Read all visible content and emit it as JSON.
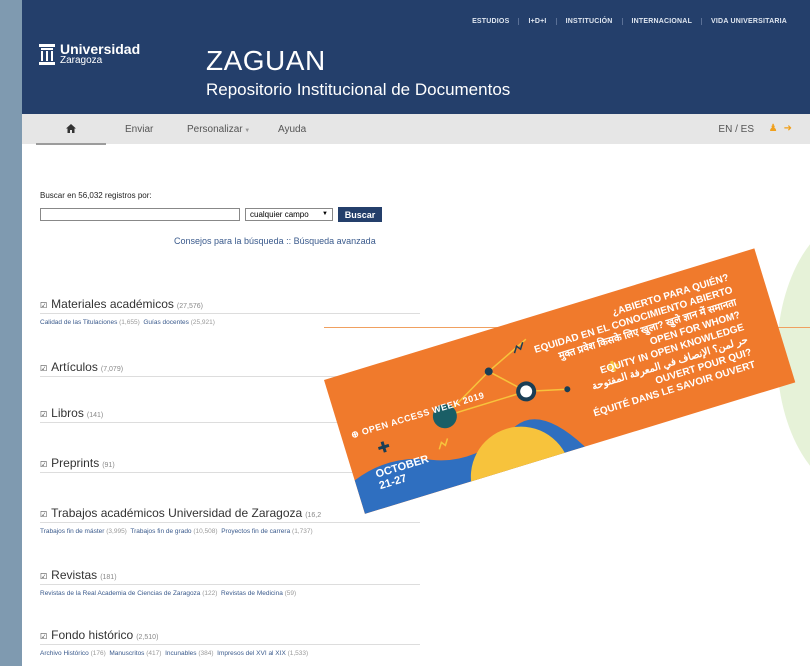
{
  "header": {
    "top_nav": [
      "ESTUDIOS",
      "I+D+I",
      "INSTITUCIÓN",
      "INTERNACIONAL",
      "VIDA UNIVERSITARIA"
    ],
    "logo_name": "Universidad",
    "logo_sub": "Zaragoza",
    "title": "ZAGUAN",
    "subtitle": "Repositorio Institucional de Documentos"
  },
  "menu": {
    "home_icon": "home-icon",
    "submit": "Enviar",
    "personalize": "Personalizar",
    "help": "Ayuda",
    "lang": "EN / ES"
  },
  "search": {
    "label": "Buscar en 56,032 registros por:",
    "input_value": "",
    "field_selected": "cualquier campo",
    "button": "Buscar",
    "tips": "Consejos para la búsqueda",
    "separator": "::",
    "advanced": "Búsqueda avanzada"
  },
  "collections": [
    {
      "title": "Materiales académicos",
      "count": "(27,576)",
      "subs": [
        {
          "name": "Calidad de las Titulaciones",
          "count": "(1,655)"
        },
        {
          "name": "Guías docentes",
          "count": "(25,921)"
        }
      ]
    },
    {
      "title": "Artículos",
      "count": "(7,079)",
      "subs": []
    },
    {
      "title": "Libros",
      "count": "(141)",
      "subs": []
    },
    {
      "title": "Preprints",
      "count": "(91)",
      "subs": []
    },
    {
      "title": "Trabajos académicos Universidad de Zaragoza",
      "count": "(16,2",
      "subs": [
        {
          "name": "Trabajos fin de máster",
          "count": "(3,995)"
        },
        {
          "name": "Trabajos fin de grado",
          "count": "(10,508)"
        },
        {
          "name": "Proyectos fin de carrera",
          "count": "(1,737)"
        }
      ]
    },
    {
      "title": "Revistas",
      "count": "(181)",
      "subs": [
        {
          "name": "Revistas de la Real Academia de Ciencias de Zaragoza",
          "count": "(122)"
        },
        {
          "name": "Revistas de Medicina",
          "count": "(59)"
        }
      ]
    },
    {
      "title": "Fondo histórico",
      "count": "(2,510)",
      "subs": [
        {
          "name": "Archivo Histórico",
          "count": "(176)"
        },
        {
          "name": "Manuscritos",
          "count": "(417)"
        },
        {
          "name": "Incunables",
          "count": "(384)"
        },
        {
          "name": "Impresos del XVI al XIX",
          "count": "(1,533)"
        }
      ]
    }
  ],
  "banner": {
    "event": "OPEN ACCESS WEEK 2019",
    "date_line1": "OCTOBER",
    "date_line2": "21-27",
    "lines": [
      "¿ABIERTO PARA QUIÉN?",
      "EQUIDAD EN EL CONOCIMIENTO ABIERTO",
      "मुक्त प्रवेश किसके लिए खुला? खुले ज्ञान में समानता",
      "OPEN FOR WHOM?",
      "EQUITY IN OPEN KNOWLEDGE",
      "حر لمن؟ الإنصاف في المعرفة المفتوحة",
      "OUVERT POUR QUI?",
      "ÉQUITÉ DANS LE SAVOIR OUVERT"
    ]
  },
  "colors": {
    "header": "#243f6b",
    "accent": "#f0a01c",
    "banner": "#f07a2c"
  }
}
